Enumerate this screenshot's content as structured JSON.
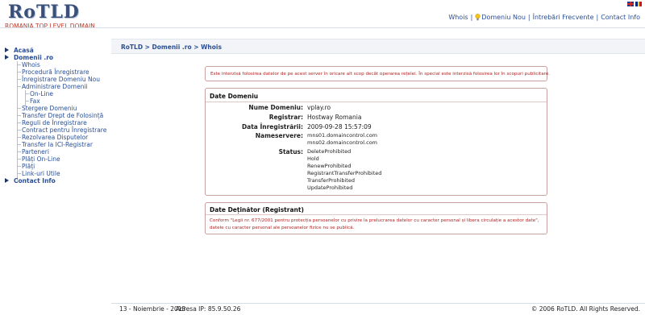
{
  "header": {
    "logo_text": "RoTLD",
    "logo_tagline": "ROMANIA TOP LEVEL DOMAIN",
    "nav": [
      {
        "label": "Whois"
      },
      {
        "label": "Domeniu Nou"
      },
      {
        "label": "Întrebări Frecvente"
      },
      {
        "label": "Contact Info"
      }
    ]
  },
  "breadcrumb": "RoTLD > Domenii .ro > Whois",
  "sidebar": {
    "items": [
      {
        "label": "Acasă",
        "level": 0
      },
      {
        "label": "Domenii .ro",
        "level": 0
      },
      {
        "label": "Whois",
        "level": 1
      },
      {
        "label": "Procedură Înregistrare",
        "level": 1
      },
      {
        "label": "Înregistrare Domeniu Nou",
        "level": 1
      },
      {
        "label": "Administrare Domenii",
        "level": 1
      },
      {
        "label": "On-Line",
        "level": 2
      },
      {
        "label": "Fax",
        "level": 2
      },
      {
        "label": "Stergere Domeniu",
        "level": 1
      },
      {
        "label": "Transfer Drept de Folosință",
        "level": 1
      },
      {
        "label": "Reguli de Înregistrare",
        "level": 1
      },
      {
        "label": "Contract pentru Înregistrare",
        "level": 1
      },
      {
        "label": "Rezolvarea Disputelor",
        "level": 1
      },
      {
        "label": "Transfer la ICI-Registrar",
        "level": 1
      },
      {
        "label": "Parteneri",
        "level": 1
      },
      {
        "label": "Plăți On-Line",
        "level": 1
      },
      {
        "label": "Plăți",
        "level": 1
      },
      {
        "label": "Link-uri Utile",
        "level": 1
      },
      {
        "label": "Contact Info",
        "level": 0
      }
    ]
  },
  "warning": "Este interzisă folosirea datelor de pe acest server în oricare alt scop decât operarea rețelei. În special este interzisă folosirea lor în scopuri publicitare.",
  "domain_data": {
    "title": "Date Domeniu",
    "fields": {
      "name_label": "Nume Domeniu:",
      "name_value": "vplay.ro",
      "registrar_label": "Registrar:",
      "registrar_value": "Hostway Romania",
      "date_label": "Data Înregistrării:",
      "date_value": "2009-09-28 15:57:09",
      "ns_label": "Nameservere:",
      "ns_values": [
        "mns01.domaincontrol.com",
        "mns02.domaincontrol.com"
      ],
      "status_label": "Status:",
      "status_values": [
        "DeleteProhibited",
        "Hold",
        "RenewProhibited",
        "RegistrantTransferProhibited",
        "TransferProhibited",
        "UpdateProhibited"
      ]
    }
  },
  "owner_data": {
    "title": "Date Deținător (Registrant)",
    "line1": "Conform \"Legii nr. 677/2001 pentru protecția persoanelor cu privire la prelucrarea datelor cu caracter personal și libera circulație a acestor date\",",
    "line2": "datele cu caracter personal ale persoanelor fizice nu se publică."
  },
  "footer": {
    "date": "13 - Noiembrie - 2013",
    "ip": "Adresa IP: 85.9.50.26",
    "copyright": "© 2006 RoTLD.     All Rights Reserved."
  },
  "colors": {
    "link": "#2a4f97",
    "warning": "#b22222",
    "box_border": "#c9a0a0"
  }
}
